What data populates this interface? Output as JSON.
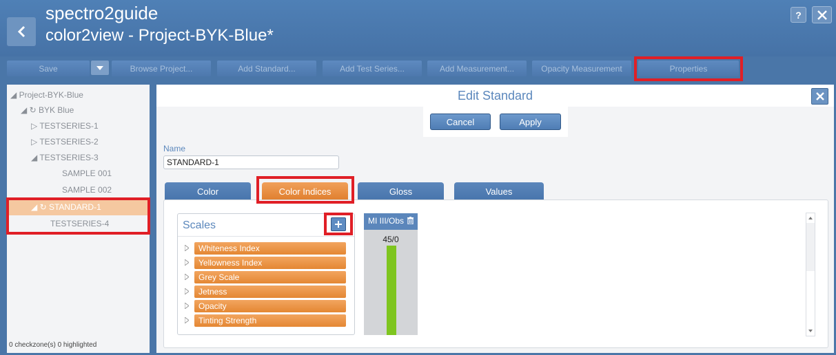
{
  "app": {
    "title": "spectro2guide",
    "subtitle": "color2view - Project-BYK-Blue*",
    "help_label": "?"
  },
  "toolbar": {
    "save_label": "Save",
    "browse_label": "Browse Project...",
    "add_standard_label": "Add Standard...",
    "add_test_series_label": "Add Test Series...",
    "add_measurement_label": "Add Measurement...",
    "opacity_label": "Opacity Measurement",
    "properties_label": "Properties"
  },
  "tree": {
    "items": [
      {
        "label": "◢ Project-BYK-Blue"
      },
      {
        "label": "◢ ↻ BYK Blue"
      },
      {
        "label": "▷ TESTSERIES-1"
      },
      {
        "label": "▷ TESTSERIES-2"
      },
      {
        "label": "◢ TESTSERIES-3"
      },
      {
        "label": "SAMPLE 001"
      },
      {
        "label": "SAMPLE 002"
      },
      {
        "label": "◢ ↻ STANDARD-1"
      },
      {
        "label": "TESTSERIES-4"
      }
    ],
    "status": "0 checkzone(s) 0 highlighted"
  },
  "edit": {
    "title": "Edit Standard",
    "cancel_label": "Cancel",
    "apply_label": "Apply",
    "name_label": "Name",
    "name_value": "STANDARD-1"
  },
  "tabs": [
    {
      "label": "Color"
    },
    {
      "label": "Color Indices"
    },
    {
      "label": "Gloss"
    },
    {
      "label": "Values"
    }
  ],
  "scales": {
    "title": "Scales",
    "items": [
      {
        "label": "Whiteness Index"
      },
      {
        "label": "Yellowness Index"
      },
      {
        "label": "Grey Scale"
      },
      {
        "label": "Jetness"
      },
      {
        "label": "Opacity"
      },
      {
        "label": "Tinting Strength"
      }
    ]
  },
  "mi_column": {
    "header": "MI III/Obs",
    "value": "45/0"
  },
  "colors": {
    "accent": "#e48733",
    "header_bg": "#4f80b6",
    "highlight": "#e01f26",
    "bar": "#7ec51f"
  }
}
